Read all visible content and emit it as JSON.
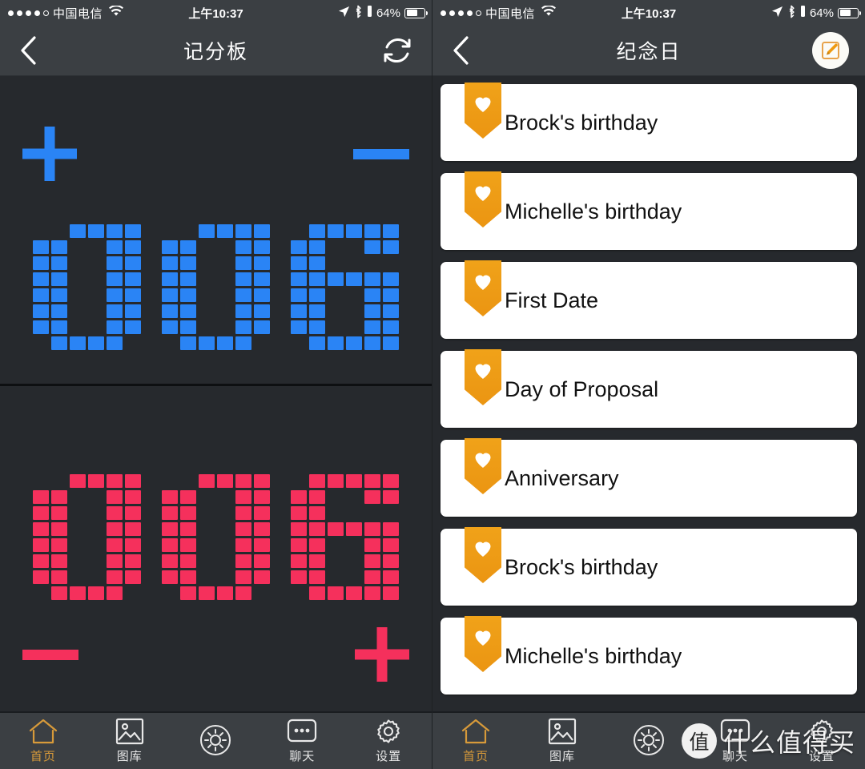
{
  "status_bar": {
    "signal_dots_filled": 4,
    "signal_dots_total": 5,
    "carrier": "中国电信",
    "wifi_icon": "wifi-icon",
    "time": "上午10:37",
    "location_icon": "location-arrow-icon",
    "bluetooth_icon": "bluetooth-icon",
    "alarm_icon": "alarm-icon",
    "battery_percent": "64%",
    "battery_level": 64
  },
  "left_screen": {
    "nav": {
      "back_icon": "chevron-left-icon",
      "title": "记分板",
      "action_icon": "refresh-icon"
    },
    "scoreboard": {
      "blue": {
        "color": "#2a84f5",
        "score": "006",
        "increment_label": "+",
        "decrement_label": "−",
        "increment_position": "left",
        "decrement_position": "right"
      },
      "red": {
        "color": "#f5305c",
        "score": "006",
        "increment_label": "+",
        "decrement_label": "−",
        "increment_position": "right",
        "decrement_position": "left"
      }
    }
  },
  "right_screen": {
    "nav": {
      "back_icon": "chevron-left-icon",
      "title": "纪念日",
      "action_icon": "edit-pencil-icon"
    },
    "list": {
      "accent_color": "#ef9a12",
      "items": [
        {
          "icon": "heart-ribbon-icon",
          "label": "Brock's birthday"
        },
        {
          "icon": "heart-ribbon-icon",
          "label": "Michelle's birthday"
        },
        {
          "icon": "heart-ribbon-icon",
          "label": "First Date"
        },
        {
          "icon": "heart-ribbon-icon",
          "label": "Day of Proposal"
        },
        {
          "icon": "heart-ribbon-icon",
          "label": "Anniversary"
        },
        {
          "icon": "heart-ribbon-icon",
          "label": "Brock's birthday"
        },
        {
          "icon": "heart-ribbon-icon",
          "label": "Michelle's birthday"
        }
      ]
    }
  },
  "tab_bar": {
    "active_color": "#d79a3a",
    "items": [
      {
        "icon": "home-icon",
        "label": "首页",
        "active": true
      },
      {
        "icon": "gallery-icon",
        "label": "图库",
        "active": false
      },
      {
        "icon": "brightness-icon",
        "label": "",
        "active": false
      },
      {
        "icon": "chat-icon",
        "label": "聊天",
        "active": false
      },
      {
        "icon": "settings-gear-icon",
        "label": "设置",
        "active": false
      }
    ]
  },
  "watermark": {
    "badge": "值",
    "text": "什么值得买"
  }
}
